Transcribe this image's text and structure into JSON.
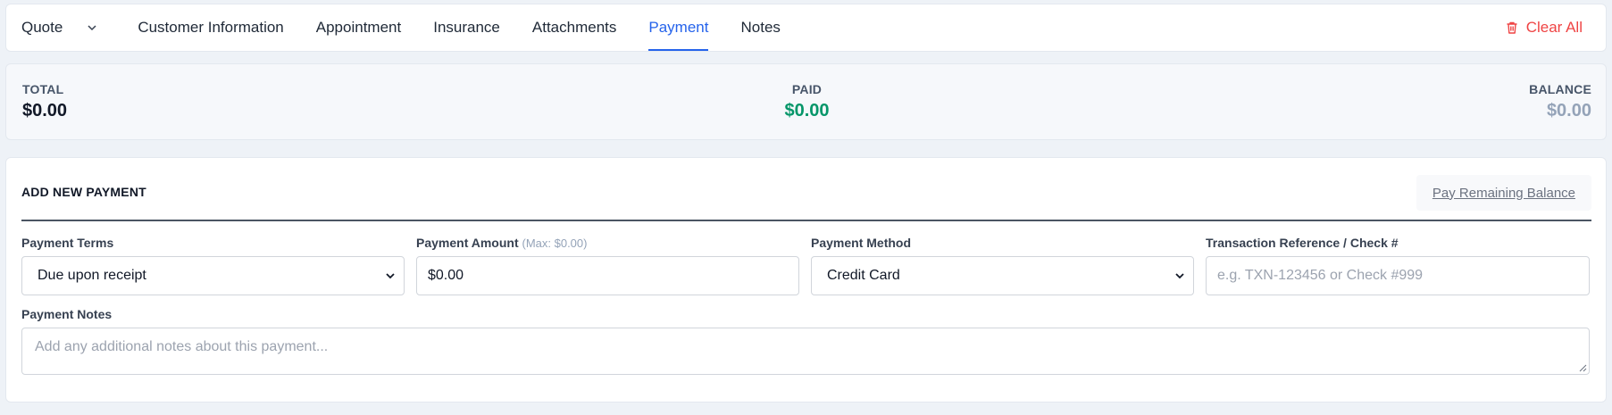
{
  "header": {
    "mode_select": "Quote",
    "tabs": [
      {
        "label": "Customer Information"
      },
      {
        "label": "Appointment"
      },
      {
        "label": "Insurance"
      },
      {
        "label": "Attachments"
      },
      {
        "label": "Payment",
        "active": true
      },
      {
        "label": "Notes"
      }
    ],
    "clear_all_label": "Clear All",
    "clear_icon": "trash-icon",
    "active_color": "#2563eb",
    "danger_color": "#ef4444"
  },
  "summary": {
    "total_label": "TOTAL",
    "total_value": "$0.00",
    "paid_label": "PAID",
    "paid_value": "$0.00",
    "paid_color": "#059669",
    "balance_label": "BALANCE",
    "balance_value": "$0.00"
  },
  "payment_form": {
    "title": "ADD NEW PAYMENT",
    "pay_remaining_label": "Pay Remaining Balance",
    "payment_terms_label": "Payment Terms",
    "payment_terms_value": "Due upon receipt",
    "payment_amount_label": "Payment Amount",
    "payment_amount_hint": "(Max: $0.00)",
    "payment_amount_value": "$0.00",
    "payment_method_label": "Payment Method",
    "payment_method_value": "Credit Card",
    "transaction_ref_label": "Transaction Reference / Check #",
    "transaction_ref_placeholder": "e.g. TXN-123456 or Check #999",
    "notes_label": "Payment Notes",
    "notes_placeholder": "Add any additional notes about this payment..."
  }
}
